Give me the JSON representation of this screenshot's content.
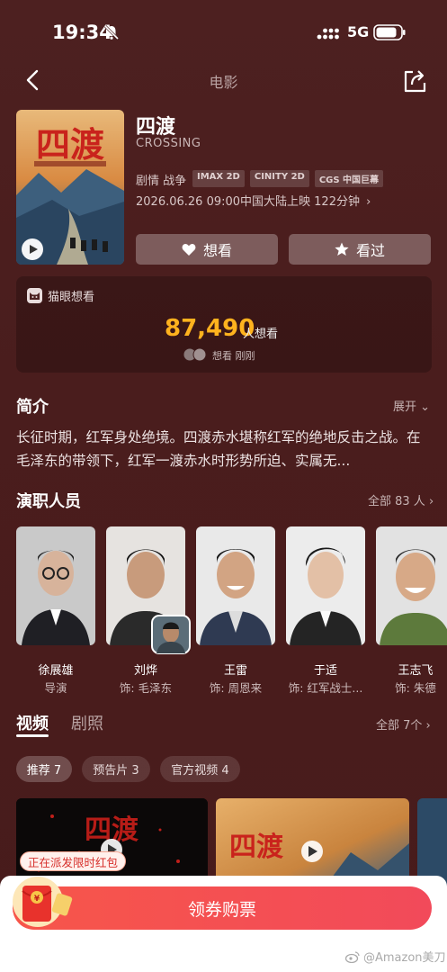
{
  "status_bar": {
    "time": "19:34",
    "network": "5G"
  },
  "nav": {
    "title": "电影"
  },
  "movie": {
    "title": "四渡",
    "subtitle": "CROSSING",
    "genre": "剧情 战争",
    "tags": [
      "IMAX 2D",
      "CINITY 2D",
      "CGS 中国巨幕"
    ],
    "release": "2026.06.26 09:00中国大陆上映 122分钟",
    "want_button": "想看",
    "seen_button": "看过",
    "poster_title": "四渡"
  },
  "maoyan": {
    "label": "猫眼想看",
    "count": "87,490",
    "unit": "人想看",
    "tip": "想看 刚刚"
  },
  "intro": {
    "title": "简介",
    "more": "展开",
    "text": "长征时期，红军身处绝境。四渡赤水堪称红军的绝地反击之战。在毛泽东的带领下，红军一渡赤水时形势所迫、实属无..."
  },
  "cast": {
    "title": "演职人员",
    "more": "全部 83 人",
    "items": [
      {
        "name": "徐展雄",
        "role": "导演"
      },
      {
        "name": "刘烨",
        "role": "饰: 毛泽东"
      },
      {
        "name": "王雷",
        "role": "饰: 周恩来"
      },
      {
        "name": "于适",
        "role": "饰: 红军战士..."
      },
      {
        "name": "王志飞",
        "role": "饰: 朱德"
      }
    ]
  },
  "videos": {
    "tab_video": "视频",
    "tab_stills": "剧照",
    "more": "全部 7个",
    "chips": [
      "推荐 7",
      "预告片 3",
      "官方视频 4"
    ]
  },
  "bottom": {
    "redpack_badge": "正在派发限时红包",
    "buy": "领券购票",
    "watermark": "@Amazon美刀"
  },
  "colors": {
    "accent": "#ffb21e",
    "buy": "#f24a5a",
    "background": "#4a1f1f"
  }
}
